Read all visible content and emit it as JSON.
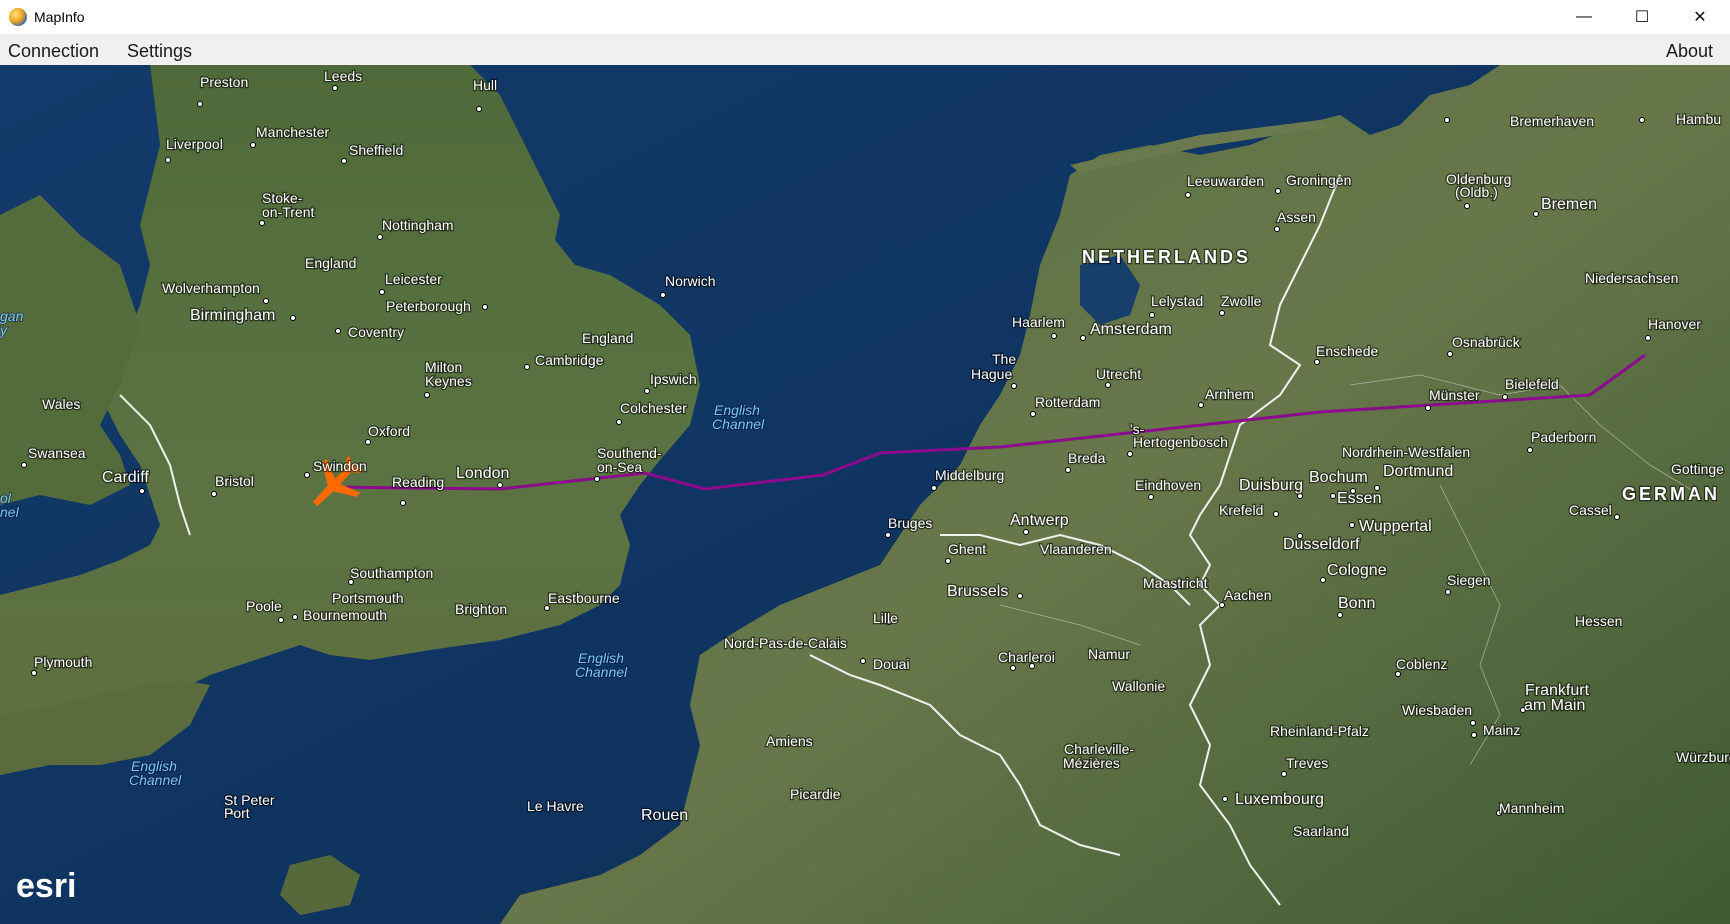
{
  "window": {
    "title": "MapInfo",
    "controls": {
      "minimize": "—",
      "maximize": "☐",
      "close": "✕"
    }
  },
  "menu": {
    "connection": "Connection",
    "settings": "Settings",
    "about": "About"
  },
  "map": {
    "attribution": "esri",
    "route_color": "#8b0a8e",
    "aircraft_color": "#ff6a00",
    "country_labels": {
      "netherlands": "NETHERLANDS",
      "germany": "GERMAN"
    },
    "water_labels": {
      "channel_north_1": "English",
      "channel_north_2": "Channel",
      "channel_mid_1": "English",
      "channel_mid_2": "Channel",
      "channel_sw_1": "English",
      "channel_sw_2": "Channel",
      "west_1": "gan",
      "west_2": "y",
      "west_3": "ol",
      "west_4": "nel"
    },
    "places": {
      "preston": "Preston",
      "leeds": "Leeds",
      "hull": "Hull",
      "liverpool": "Liverpool",
      "manchester": "Manchester",
      "sheffield": "Sheffield",
      "stoke1": "Stoke-",
      "stoke2": "on-Trent",
      "nottingham": "Nottingham",
      "england1": "England",
      "leicester": "Leicester",
      "wolverhampton": "Wolverhampton",
      "peterborough": "Peterborough",
      "norwich": "Norwich",
      "birmingham": "Birmingham",
      "coventry": "Coventry",
      "england2": "England",
      "cambridge": "Cambridge",
      "milton1": "Milton",
      "milton2": "Keynes",
      "ipswich": "Ipswich",
      "wales": "Wales",
      "colchester": "Colchester",
      "oxford": "Oxford",
      "swansea": "Swansea",
      "swindon": "Swindon",
      "london": "London",
      "southend1": "Southend-",
      "southend2": "on-Sea",
      "cardiff": "Cardiff",
      "bristol": "Bristol",
      "reading": "Reading",
      "southampton": "Southampton",
      "poole": "Poole",
      "portsmouth": "Portsmouth",
      "bournemouth": "Bournemouth",
      "brighton": "Brighton",
      "eastbourne": "Eastbourne",
      "plymouth": "Plymouth",
      "stpeter1": "St Peter",
      "stpeter2": "Port",
      "leeuwarden": "Leeuwarden",
      "groningen": "Groningen",
      "assen": "Assen",
      "haarlem": "Haarlem",
      "amsterdam": "Amsterdam",
      "lelystad": "Lelystad",
      "zwolle": "Zwolle",
      "hague1": "The",
      "hague2": "Hague",
      "utrecht": "Utrecht",
      "rotterdam": "Rotterdam",
      "arnhem": "Arnhem",
      "enschede": "Enschede",
      "hertogenbosch1": "'s-",
      "hertogenbosch2": "Hertogenbosch",
      "breda": "Breda",
      "middelburg": "Middelburg",
      "eindhoven": "Eindhoven",
      "bruges": "Bruges",
      "antwerp": "Antwerp",
      "ghent": "Ghent",
      "vlaanderen": "Vlaanderen",
      "brussels": "Brussels",
      "maastricht": "Maastricht",
      "lille": "Lille",
      "nordpas": "Nord-Pas-de-Calais",
      "douai": "Douai",
      "charleroi": "Charleroi",
      "namur": "Namur",
      "wallonie": "Wallonie",
      "amiens": "Amiens",
      "picardie": "Picardie",
      "charleville1": "Charleville-",
      "charleville2": "Mézières",
      "lehavre": "Le Havre",
      "rouen": "Rouen",
      "luxembourg": "Luxembourg",
      "saarland": "Saarland",
      "bremerhaven": "Bremerhaven",
      "hamburg": "Hambu",
      "oldenburg1": "Oldenburg",
      "oldenburg2": "(Oldb.)",
      "bremen": "Bremen",
      "niedersachsen": "Niedersachsen",
      "hanover": "Hanover",
      "osnabruck": "Osnabrück",
      "bielefeld": "Bielefeld",
      "munster": "Münster",
      "paderborn": "Paderborn",
      "nrw": "Nordrhein-Westfalen",
      "duisburg": "Duisburg",
      "bochum": "Bochum",
      "dortmund": "Dortmund",
      "essen": "Essen",
      "krefeld": "Krefeld",
      "wuppertal": "Wuppertal",
      "dusseldorf": "Dusseldorf",
      "kassel": "Cassel",
      "gottingen": "Gottinge",
      "cologne": "Cologne",
      "bonn": "Bonn",
      "siegen": "Siegen",
      "aachen": "Aachen",
      "hessen": "Hessen",
      "koblenz": "Coblenz",
      "frankfurt1": "Frankfurt",
      "frankfurt2": "am Main",
      "wiesbaden": "Wiesbaden",
      "mainz": "Mainz",
      "rheinland": "Rheinland-Pfalz",
      "treves": "Treves",
      "mannheim": "Mannheim",
      "wurzburg": "Würzburg"
    }
  }
}
